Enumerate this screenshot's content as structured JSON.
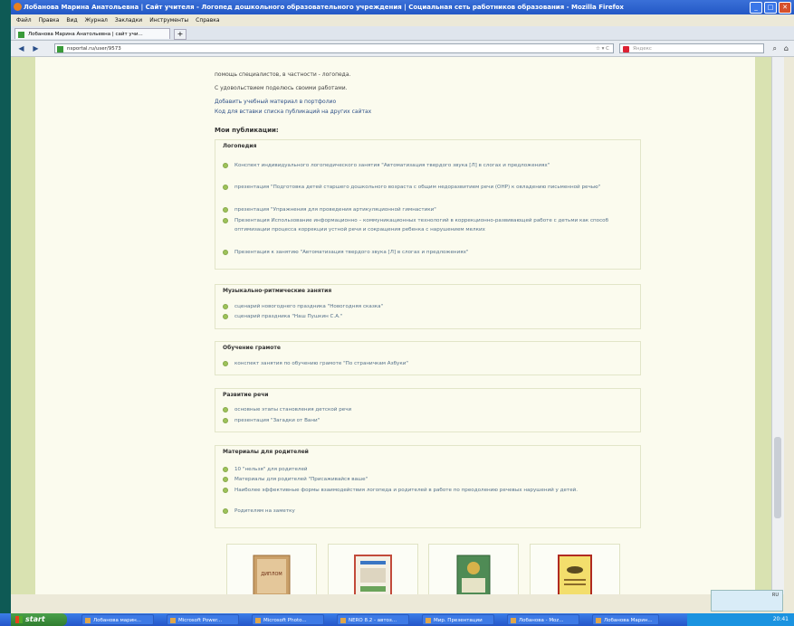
{
  "window": {
    "title": "Лобанова Марина Анатольевна | Сайт учителя - Логопед дошкольного образовательного учреждения | Социальная сеть работников образования - Mozilla Firefox"
  },
  "menu": [
    "Файл",
    "Правка",
    "Вид",
    "Журнал",
    "Закладки",
    "Инструменты",
    "Справка"
  ],
  "tab": {
    "label": "Лобанова Марина Анатольевна | сайт учи..."
  },
  "address": {
    "url": "nsportal.ru/user/9573",
    "search_placeholder": "Яндекс"
  },
  "content": {
    "intro_lines": [
      "помощь специалистов, в частности - логопеда.",
      "С удовольствием поделюсь своими работами.",
      "Добавить учебный материал в портфолио",
      "Код для вставки списка публикаций на других сайтах"
    ],
    "pubs_title": "Мои публикации:",
    "sections": [
      {
        "title": "Логопедия",
        "items": [
          "Конспект индивидуального логопедического занятия \"Автоматизация твердого звука [Л] в слогах и предложениях\"",
          "презентация \"Подготовка детей старшего дошкольного возраста с общим недоразвитием речи (ОНР) к овладению письменной речью\"",
          "презентация \"Упражнения для проведения артикуляционной гимнастики\"",
          "Презентация Использование информационно – коммуникационных технологий в коррекционно-развивающей работе с детьми как способ оптимизации процесса коррекции устной речи и сокращения ребенка с нарушением мелких",
          "Презентация к занятию \"Автоматизация твердого звука [Л] в слогах и предложениях\""
        ]
      },
      {
        "title": "Музыкально-ритмические занятия",
        "items": [
          "сценарий новогоднего праздника \"Новогодняя сказка\"",
          "сценарий праздника \"Наш Пушкин С.А.\""
        ]
      },
      {
        "title": "Обучение грамоте",
        "items": [
          "конспект занятия по обучению грамоте \"По страничкам Азбуки\""
        ]
      },
      {
        "title": "Развитие речи",
        "items": [
          "основные этапы становления детской речи",
          "презентация \"Загадки от Вани\""
        ]
      },
      {
        "title": "Материалы для родителей",
        "items": [
          "10 \"нельзя\" для родителей",
          "Материалы для родителей \"Присаживайся ваше\"",
          "Наиболее эффективные формы взаимодействия логопеда и родителей в работе по преодолению речевых нарушений у детей.",
          "Родителям на заметку"
        ]
      }
    ],
    "certificates": [
      {
        "kind": "diploma-tan",
        "label": "ДИПЛОМ"
      },
      {
        "kind": "diploma-multicolor",
        "label": ""
      },
      {
        "kind": "diploma-green",
        "label": ""
      },
      {
        "kind": "diploma-gold",
        "label": ""
      }
    ]
  },
  "taskbar": {
    "start_label": "start",
    "buttons": [
      "Лобанова марин...",
      "Microsoft Power...",
      "Microsoft Photo...",
      "NERO 8.2 - автоз...",
      "Мир. Презентации",
      "Лобанова - Moz...",
      "Лобанова Марин..."
    ],
    "clock": "20:41",
    "lang": "RU"
  },
  "colors": {
    "titlebar": "#2358c5",
    "page_bg": "#d9e2b1",
    "link": "#54708a",
    "bullet": "#9ec35a",
    "taskbar": "#2456c9",
    "desktop": "#0e5a55"
  }
}
